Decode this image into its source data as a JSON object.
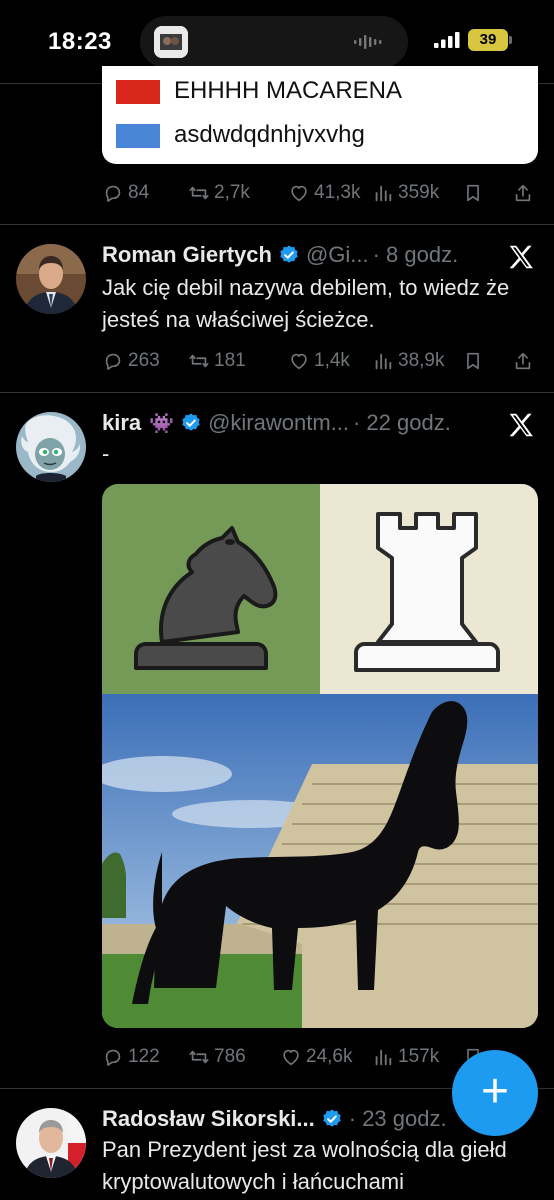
{
  "status_bar": {
    "time": "18:23",
    "battery": "39",
    "icons": [
      "dynamic-island-thumbnail",
      "audio-wave-icon",
      "signal-bars-icon",
      "battery-icon"
    ]
  },
  "legend_card": {
    "items": [
      {
        "label": "EHHHH MACARENA",
        "color": "#d9261c"
      },
      {
        "label": "asdwdqdnhjvxvhg",
        "color": "#4a86d8"
      }
    ]
  },
  "tweets": [
    {
      "actions": {
        "replies": "84",
        "reposts": "2,7k",
        "likes": "41,3k",
        "views": "359k"
      }
    },
    {
      "name": "Roman Giertych",
      "handle": "@Gi...",
      "time": "· 8 godz.",
      "text": "Jak cię debil nazywa debilem, to wiedz że jesteś na właściwej ścieżce.",
      "actions": {
        "replies": "263",
        "reposts": "181",
        "likes": "1,4k",
        "views": "38,9k"
      }
    },
    {
      "name": "kira",
      "emoji": "👾",
      "handle": "@kirawontm...",
      "time": "· 22 godz.",
      "text": "-",
      "actions": {
        "replies": "122",
        "reposts": "786",
        "likes": "24,6k",
        "views": "157k"
      }
    },
    {
      "name": "Radosław Sikorski...",
      "handle": "",
      "time": "· 23 godz.",
      "text": "Pan Prezydent jest za wolnością dla giełd kryptowalutowych i łańcuchami"
    }
  ],
  "colors": {
    "accent": "#1d9bf0",
    "muted": "#71767b",
    "divider": "#2f3336",
    "chess_green": "#759a58",
    "chess_cream": "#ebe7d3"
  },
  "fab": {
    "label": "+",
    "icon": "compose-plus-icon"
  }
}
